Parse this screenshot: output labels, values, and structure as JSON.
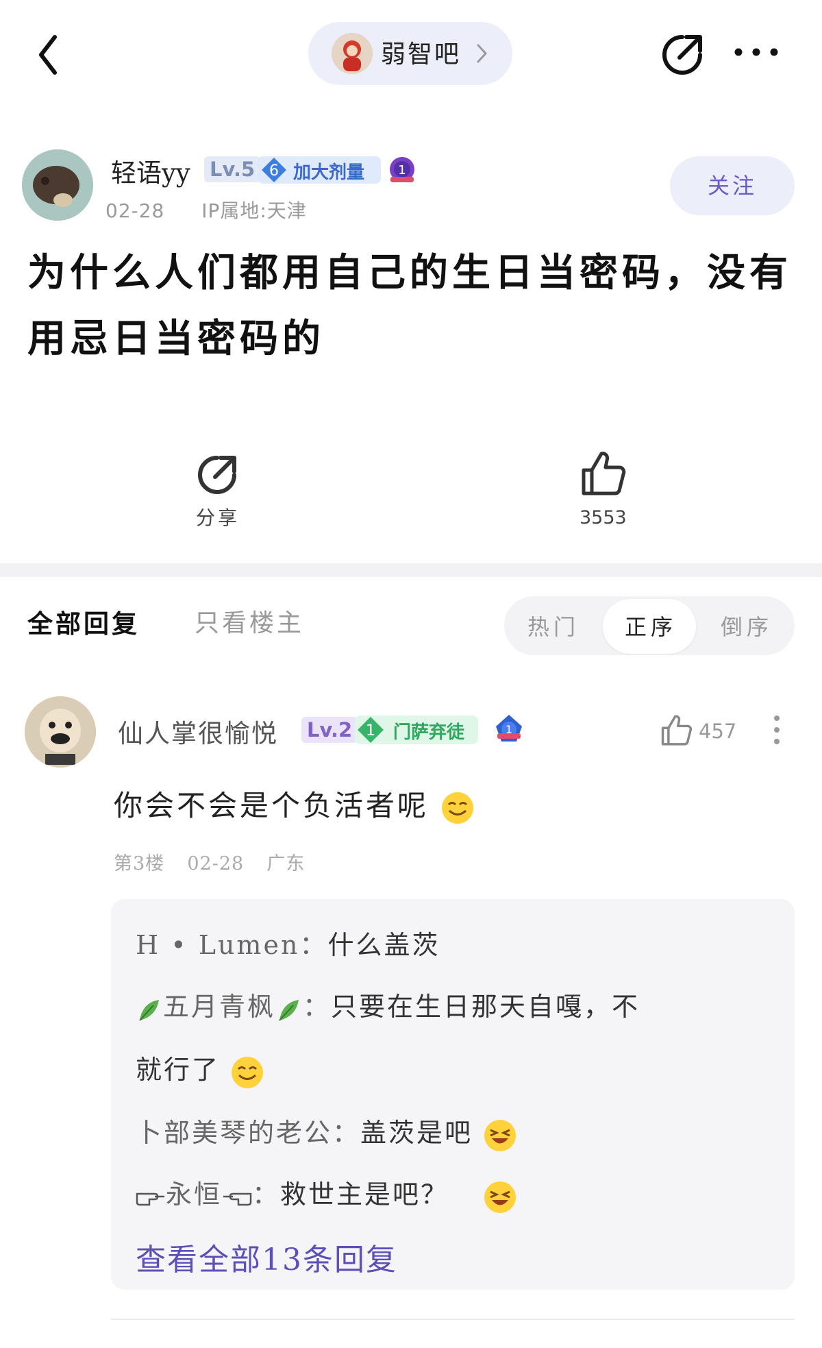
{
  "topbar": {
    "forum_name": "弱智吧"
  },
  "post": {
    "author": {
      "name": "轻语yy",
      "level": "Lv.5",
      "title_level": "6",
      "title": "加大剂量",
      "medal_number": "1"
    },
    "date": "02-28",
    "ip_location": "IP属地:天津",
    "follow_label": "关注",
    "title": "为什么人们都用自己的生日当密码，没有用忌日当密码的",
    "share_label": "分享",
    "like_count": "3553"
  },
  "tabs": {
    "all": "全部回复",
    "op_only": "只看楼主",
    "sort_hot": "热门",
    "sort_asc": "正序",
    "sort_desc": "倒序",
    "selected_sort": "正序"
  },
  "reply": {
    "author": "仙人掌很愉悦",
    "level": "Lv.2",
    "badge_level": "1",
    "badge_title": "门萨弃徒",
    "medal_number": "1",
    "like_count": "457",
    "text": "你会不会是个负活者呢",
    "floor": "第3楼",
    "date": "02-28",
    "location": "广东",
    "sub_replies": [
      {
        "author": "H • Lumen",
        "text": "什么盖茨"
      },
      {
        "author": "五月青枫",
        "text": "只要在生日那天自嘎，不",
        "text_cont": "就行了"
      },
      {
        "author": "卜部美琴的老公",
        "text": "盖茨是吧"
      },
      {
        "author": "永恒",
        "text": "救世主是吧？"
      }
    ],
    "view_all": "查看全部13条回复"
  },
  "colors": {
    "accent": "#6a5bc0",
    "pill_bg": "#eceef9",
    "link": "#5c4fb8"
  },
  "icons": [
    "back-arrow-icon",
    "chevron-right-icon",
    "share-icon",
    "more-icon",
    "thumbs-up-icon",
    "medal-icon",
    "smile-emoji-icon",
    "grin-emoji-icon",
    "leaf-icon",
    "pointing-hand-icon"
  ]
}
